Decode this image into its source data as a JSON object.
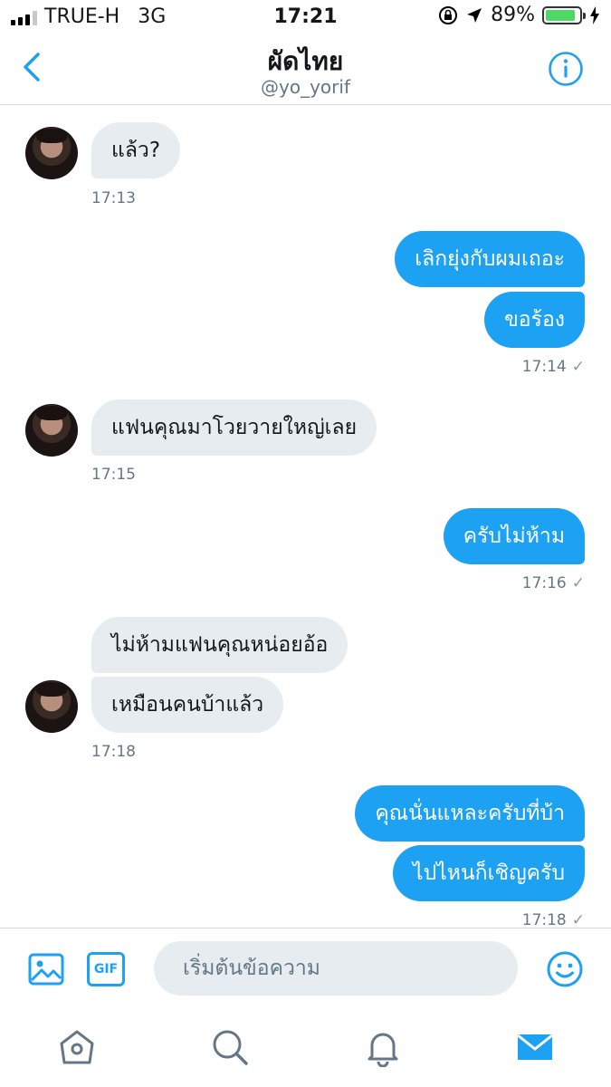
{
  "status_bar": {
    "carrier": "TRUE-H",
    "network": "3G",
    "time": "17:21",
    "battery": "89%",
    "battery_level": 0.89,
    "battery_color": "#4cd964"
  },
  "header": {
    "title": "ผัดไทย",
    "handle": "@yo_yorif",
    "back_icon": "chevron-left-icon",
    "info_icon": "info-icon"
  },
  "messages": [
    {
      "text": "แล้ว?"
    },
    {
      "text": "17:13"
    },
    {
      "text": "เลิกยุ่งกับผมเถอะ"
    },
    {
      "text": "ขอร้อง"
    },
    {
      "text": "17:14"
    },
    {
      "text": "แฟนคุณมาโวยวายใหญ่เลย"
    },
    {
      "text": "17:15"
    },
    {
      "text": "ครับไม่ห้าม"
    },
    {
      "text": "17:16"
    },
    {
      "text": "ไม่ห้ามแฟนคุณหน่อยอ้อ"
    },
    {
      "text": "เหมือนคนบ้าแล้ว"
    },
    {
      "text": "17:18"
    },
    {
      "text": "คุณนั่นแหละครับที่บ้า"
    },
    {
      "text": "ไปไหนก็เชิญครับ"
    },
    {
      "text": "17:18"
    }
  ],
  "read_mark": "✓",
  "composer": {
    "placeholder": "เริ่มต้นข้อความ",
    "gif_label": "GIF"
  },
  "colors": {
    "accent": "#1da1f2",
    "incoming_bubble": "#e6ecf0"
  }
}
